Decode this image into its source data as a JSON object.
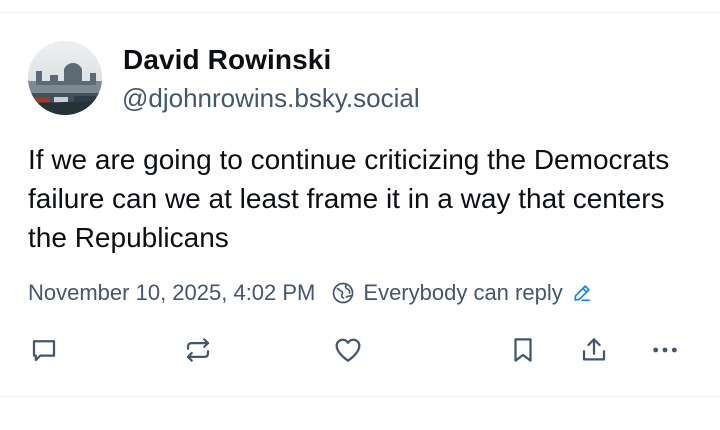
{
  "post": {
    "author_name": "David Rowinski",
    "author_handle": "@djohnrowins.bsky.social",
    "text": "If we are going to continue criticizing the Democrats failure can we at least frame it in a way that centers the Republicans",
    "timestamp": "November 10, 2025, 4:02 PM",
    "reply_setting": "Everybody can reply"
  },
  "icons": {
    "reply": "reply-icon",
    "repost": "repost-icon",
    "like": "heart-icon",
    "bookmark": "bookmark-icon",
    "share": "share-icon",
    "more": "more-icon",
    "globe": "globe-icon",
    "edit": "pencil-icon"
  },
  "colors": {
    "text": "#0b0f14",
    "muted": "#42576c",
    "link": "#1083fe",
    "icon": "#42576c",
    "divider": "#e9edf1"
  }
}
